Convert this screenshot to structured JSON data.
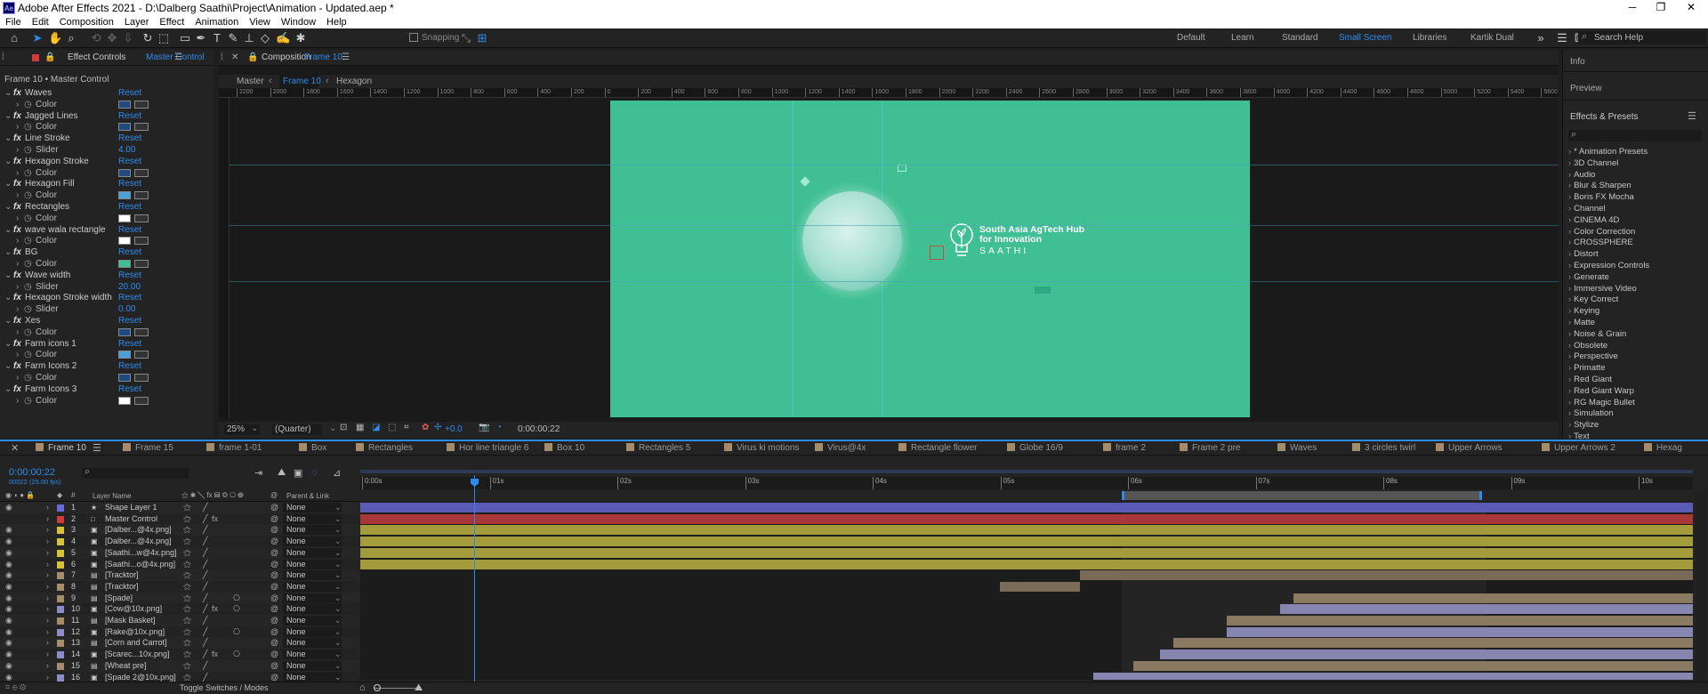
{
  "window": {
    "title": "Adobe After Effects 2021 - D:\\Dalberg Saathi\\Project\\Animation - Updated.aep *",
    "logo": "Ae"
  },
  "menu": [
    "File",
    "Edit",
    "Composition",
    "Layer",
    "Effect",
    "Animation",
    "View",
    "Window",
    "Help"
  ],
  "toolbar": {
    "snapping": "Snapping",
    "workspaces": [
      "Default",
      "Learn",
      "Standard",
      "Small Screen",
      "Libraries",
      "Kartik Dual"
    ],
    "active_workspace": "Small Screen",
    "search_placeholder": "Search Help"
  },
  "effect_controls": {
    "tab": "Effect Controls",
    "target": "Master Control",
    "header": "Frame 10 • Master Control",
    "effects": [
      {
        "name": "Waves",
        "reset": "Reset",
        "param": "Color",
        "swatch": "#1f4a80"
      },
      {
        "name": "Jagged Lines",
        "reset": "Reset",
        "param": "Color",
        "swatch": "#1f4a80"
      },
      {
        "name": "Line Stroke",
        "reset": "Reset",
        "param": "Slider",
        "value": "4.00"
      },
      {
        "name": "Hexagon Stroke",
        "reset": "Reset",
        "param": "Color",
        "swatch": "#1f4a80"
      },
      {
        "name": "Hexagon Fill",
        "reset": "Reset",
        "param": "Color",
        "swatch": "#4aa0d8"
      },
      {
        "name": "Rectangles",
        "reset": "Reset",
        "param": "Color",
        "swatch": "#ffffff"
      },
      {
        "name": "wave wala rectangle",
        "reset": "Reset",
        "param": "Color",
        "swatch": "#ffffff"
      },
      {
        "name": "BG",
        "reset": "Reset",
        "param": "Color",
        "swatch": "#3fbf93"
      },
      {
        "name": "Wave width",
        "reset": "Reset",
        "param": "Slider",
        "value": "20.00"
      },
      {
        "name": "Hexagon Stroke width",
        "reset": "Reset",
        "param": "Slider",
        "value": "0.00"
      },
      {
        "name": "Xes",
        "reset": "Reset",
        "param": "Color",
        "swatch": "#1f4a80"
      },
      {
        "name": "Farm icons 1",
        "reset": "Reset",
        "param": "Color",
        "swatch": "#4aa0d8"
      },
      {
        "name": "Farm Icons 2",
        "reset": "Reset",
        "param": "Color",
        "swatch": "#1f4a80"
      },
      {
        "name": "Farm Icons 3",
        "reset": "Reset",
        "param": "Color",
        "swatch": "#ffffff"
      }
    ]
  },
  "composition": {
    "tab": "Composition",
    "name": "Frame 10",
    "breadcrumbs": [
      "Master",
      "Frame 10",
      "Hexagon"
    ],
    "ruler": [
      "2200",
      "2000",
      "1800",
      "1600",
      "1400",
      "1200",
      "1000",
      "800",
      "600",
      "400",
      "200",
      "0",
      "200",
      "400",
      "600",
      "800",
      "1000",
      "1200",
      "1400",
      "1600",
      "1800",
      "2000",
      "2200",
      "2400",
      "2600",
      "2800",
      "3000",
      "3200",
      "3400",
      "3600",
      "3800",
      "4000",
      "4200",
      "4400",
      "4600",
      "4800",
      "5000",
      "5200",
      "5400",
      "5600"
    ],
    "bg_color": "#3fbf93",
    "logo": {
      "line1": "South Asia AgTech Hub",
      "line2": "for Innovation",
      "line3": "SAATHI"
    },
    "footer": {
      "zoom": "25%",
      "resolution": "(Quarter)",
      "exposure": "+0.0",
      "timecode": "0:00:00:22"
    }
  },
  "right_panel": {
    "info": "Info",
    "preview": "Preview",
    "effects_presets": "Effects & Presets",
    "search_placeholder": "",
    "items": [
      "* Animation Presets",
      "3D Channel",
      "Audio",
      "Blur & Sharpen",
      "Boris FX Mocha",
      "Channel",
      "CINEMA 4D",
      "Color Correction",
      "CROSSPHERE",
      "Distort",
      "Expression Controls",
      "Generate",
      "Immersive Video",
      "Key Correct",
      "Keying",
      "Matte",
      "Noise & Grain",
      "Obsolete",
      "Perspective",
      "Primatte",
      "Red Giant",
      "Red Giant Warp",
      "RG Magic Bullet",
      "Simulation",
      "Stylize",
      "Text"
    ]
  },
  "timeline": {
    "tabs": [
      "Frame 10",
      "Frame 15",
      "frame 1-01",
      "Box",
      "Rectangles",
      "Hor line triangle 6",
      "Box 10",
      "Rectangles 5",
      "Virus ki motions",
      "Virus@4x",
      "Rectangle flower",
      "Globe 16/9",
      "frame 2",
      "Frame 2 pre",
      "Waves",
      "3 circles twirl",
      "Upper Arrows",
      "Upper Arrows 2",
      "Hexag"
    ],
    "timecode": "0:00:00:22",
    "fps": "00022 (25.00 fps)",
    "col_layer_name": "Layer Name",
    "col_parent": "Parent & Link",
    "ticks": [
      "0:00s",
      "01s",
      "02s",
      "03s",
      "04s",
      "05s",
      "06s",
      "07s",
      "08s",
      "09s",
      "10s"
    ],
    "toggle": "Toggle Switches / Modes",
    "layers": [
      {
        "n": "1",
        "name": "Shape Layer 1",
        "label": "#6a6ad6",
        "parent": "None",
        "bar": "#5b5bb5",
        "start": 0,
        "end": 100,
        "icon": "★"
      },
      {
        "n": "2",
        "name": "Master Control",
        "label": "#d13a3a",
        "parent": "None",
        "bar": "#a83838",
        "start": 0,
        "end": 100,
        "icon": "□"
      },
      {
        "n": "3",
        "name": "[Dalber...@4x.png]",
        "label": "#d8c23a",
        "parent": "None",
        "bar": "#a39b3c",
        "start": 0,
        "end": 100,
        "icon": "▣"
      },
      {
        "n": "4",
        "name": "[Dalber...@4x.png]",
        "label": "#d8c23a",
        "parent": "None",
        "bar": "#a39b3c",
        "start": 0,
        "end": 100,
        "icon": "▣"
      },
      {
        "n": "5",
        "name": "[Saathi...w@4x.png]",
        "label": "#d8c23a",
        "parent": "None",
        "bar": "#a39b3c",
        "start": 0,
        "end": 100,
        "icon": "▣"
      },
      {
        "n": "6",
        "name": "[Saathi...o@4x.png]",
        "label": "#d8c23a",
        "parent": "None",
        "bar": "#a39b3c",
        "start": 0,
        "end": 100,
        "icon": "▣"
      },
      {
        "n": "7",
        "name": "[Tracktor]",
        "label": "#a58c6a",
        "parent": "None",
        "bar": "#7a6a58",
        "start": 54,
        "end": 100,
        "icon": "▤"
      },
      {
        "n": "8",
        "name": "[Tracktor]",
        "label": "#a58c6a",
        "parent": "None",
        "bar": "#7a6a58",
        "start": 48,
        "end": 54,
        "icon": "▤"
      },
      {
        "n": "9",
        "name": "[Spade]",
        "label": "#a58c6a",
        "parent": "None",
        "bar": "#8a7a62",
        "start": 70,
        "end": 100,
        "icon": "▤"
      },
      {
        "n": "10",
        "name": "[Cow@10x.png]",
        "label": "#8c8cc8",
        "parent": "None",
        "bar": "#8686b0",
        "start": 69,
        "end": 100,
        "icon": "▣"
      },
      {
        "n": "11",
        "name": "[Mask Basket]",
        "label": "#a58c6a",
        "parent": "None",
        "bar": "#8a7a62",
        "start": 65,
        "end": 100,
        "icon": "▤"
      },
      {
        "n": "12",
        "name": "[Rake@10x.png]",
        "label": "#8c8cc8",
        "parent": "None",
        "bar": "#8686b0",
        "start": 65,
        "end": 100,
        "icon": "▣"
      },
      {
        "n": "13",
        "name": "[Corn and Carrot]",
        "label": "#a58c6a",
        "parent": "None",
        "bar": "#8a7a62",
        "start": 61,
        "end": 100,
        "icon": "▤"
      },
      {
        "n": "14",
        "name": "[Scarec...10x.png]",
        "label": "#8c8cc8",
        "parent": "None",
        "bar": "#8686b0",
        "start": 60,
        "end": 100,
        "icon": "▣"
      },
      {
        "n": "15",
        "name": "[Wheat pre]",
        "label": "#a58c6a",
        "parent": "None",
        "bar": "#8a7a62",
        "start": 58,
        "end": 100,
        "icon": "▤"
      },
      {
        "n": "16",
        "name": "[Spade 2@10x.png]",
        "label": "#8c8cc8",
        "parent": "None",
        "bar": "#8686b0",
        "start": 55,
        "end": 100,
        "icon": "▣"
      }
    ]
  }
}
